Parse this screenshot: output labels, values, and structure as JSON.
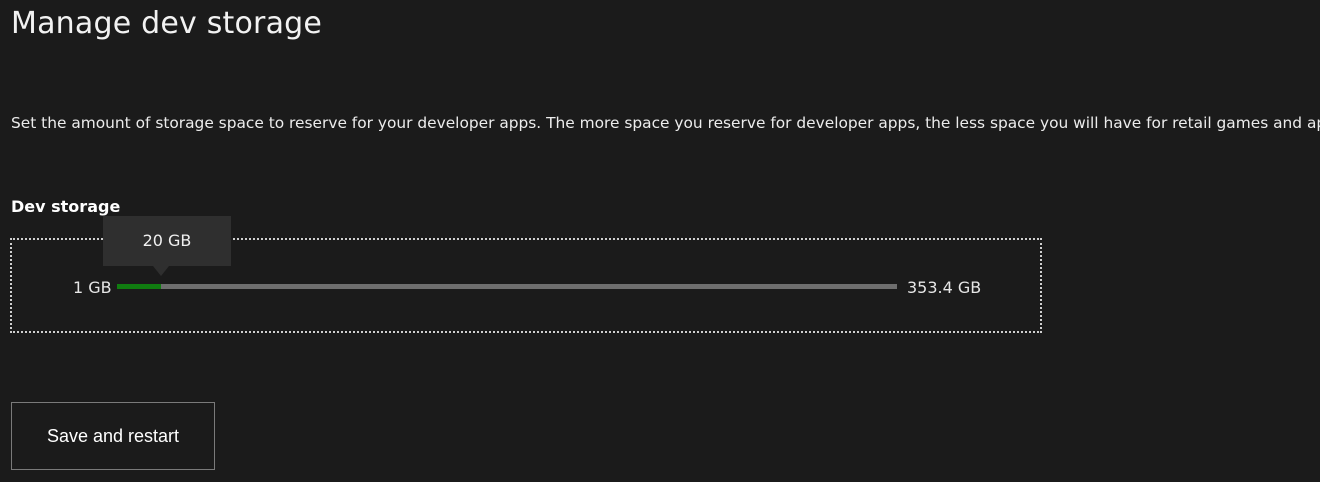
{
  "page": {
    "title": "Manage dev storage",
    "description": "Set the amount of storage space to reserve for your developer apps. The more space you reserve for developer apps, the less space you will have for retail games and apps."
  },
  "dev_storage": {
    "label": "Dev storage",
    "min_label": "1 GB",
    "max_label": "353.4 GB",
    "value_label": "20 GB",
    "min_value": 1,
    "max_value": 353.4,
    "value": 20,
    "colors": {
      "fill": "#107c10",
      "track": "#6e6e6e"
    }
  },
  "actions": {
    "save_label": "Save and restart"
  }
}
